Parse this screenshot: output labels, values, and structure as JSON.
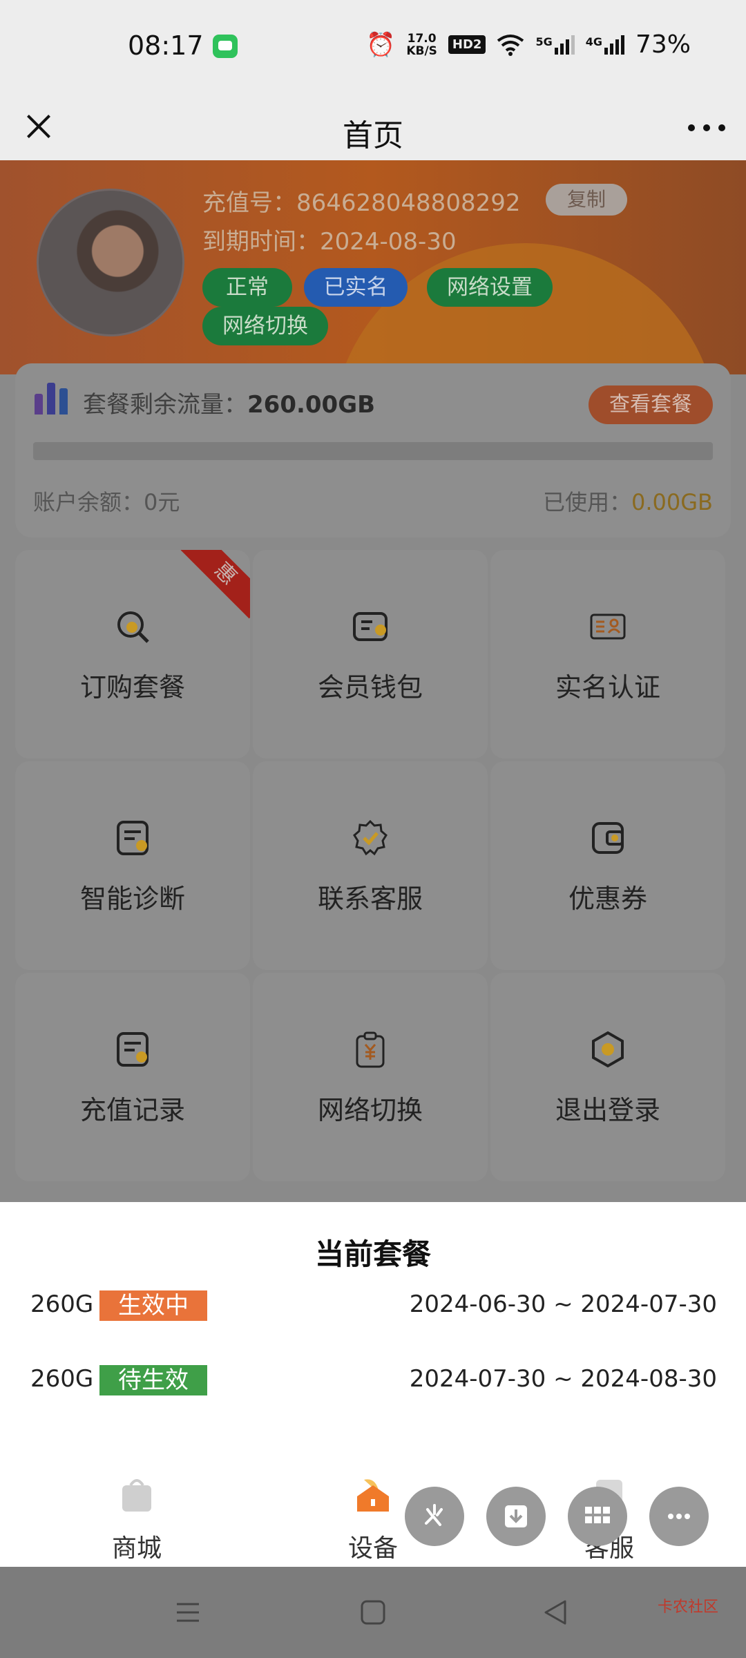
{
  "status_bar": {
    "time": "08:17",
    "speed_value": "17.0",
    "speed_unit": "KB/S",
    "hd_label": "HD2",
    "net_5g": "5G",
    "net_4g": "4G",
    "battery": "73%"
  },
  "title_bar": {
    "title": "首页"
  },
  "account": {
    "recharge_label": "充值号：",
    "recharge_number": "864628048808292",
    "copy_label": "复制",
    "expiry_label": "到期时间：",
    "expiry_date": "2024-08-30",
    "tags": [
      "正常",
      "已实名",
      "网络设置",
      "网络切换"
    ]
  },
  "flow": {
    "remaining_label": "套餐剩余流量：",
    "remaining_value": "260.00GB",
    "view_plan_label": "查看套餐",
    "usage_fraction": 0,
    "balance_label": "账户余额：",
    "balance_value": "0元",
    "used_label": "已使用：",
    "used_value": "0.00GB"
  },
  "grid": {
    "ribbon": "惠",
    "items": [
      {
        "label": "订购套餐",
        "icon": "search-icon"
      },
      {
        "label": "会员钱包",
        "icon": "ticket-icon"
      },
      {
        "label": "实名认证",
        "icon": "id-card-icon"
      },
      {
        "label": "智能诊断",
        "icon": "document-icon"
      },
      {
        "label": "联系客服",
        "icon": "badge-check-icon"
      },
      {
        "label": "优惠券",
        "icon": "wallet-icon"
      },
      {
        "label": "充值记录",
        "icon": "document-icon"
      },
      {
        "label": "网络切换",
        "icon": "clipboard-yuan-icon"
      },
      {
        "label": "退出登录",
        "icon": "hexagon-icon"
      }
    ]
  },
  "current_plan": {
    "title": "当前套餐",
    "plans": [
      {
        "size": "260G",
        "status": "生效中",
        "range": "2024-06-30 ~ 2024-07-30"
      },
      {
        "size": "260G",
        "status": "待生效",
        "range": "2024-07-30 ~ 2024-08-30"
      }
    ]
  },
  "tabs": [
    {
      "label": "商城",
      "icon": "shopping-bag-icon"
    },
    {
      "label": "设备",
      "icon": "home-icon"
    },
    {
      "label": "客服",
      "icon": "service-icon"
    }
  ],
  "watermark": "卡农社区",
  "colors": {
    "accent_orange": "#e9733a",
    "status_green": "#3f9f48",
    "tag_blue": "#245bb0",
    "ribbon_red": "#a3211a"
  }
}
